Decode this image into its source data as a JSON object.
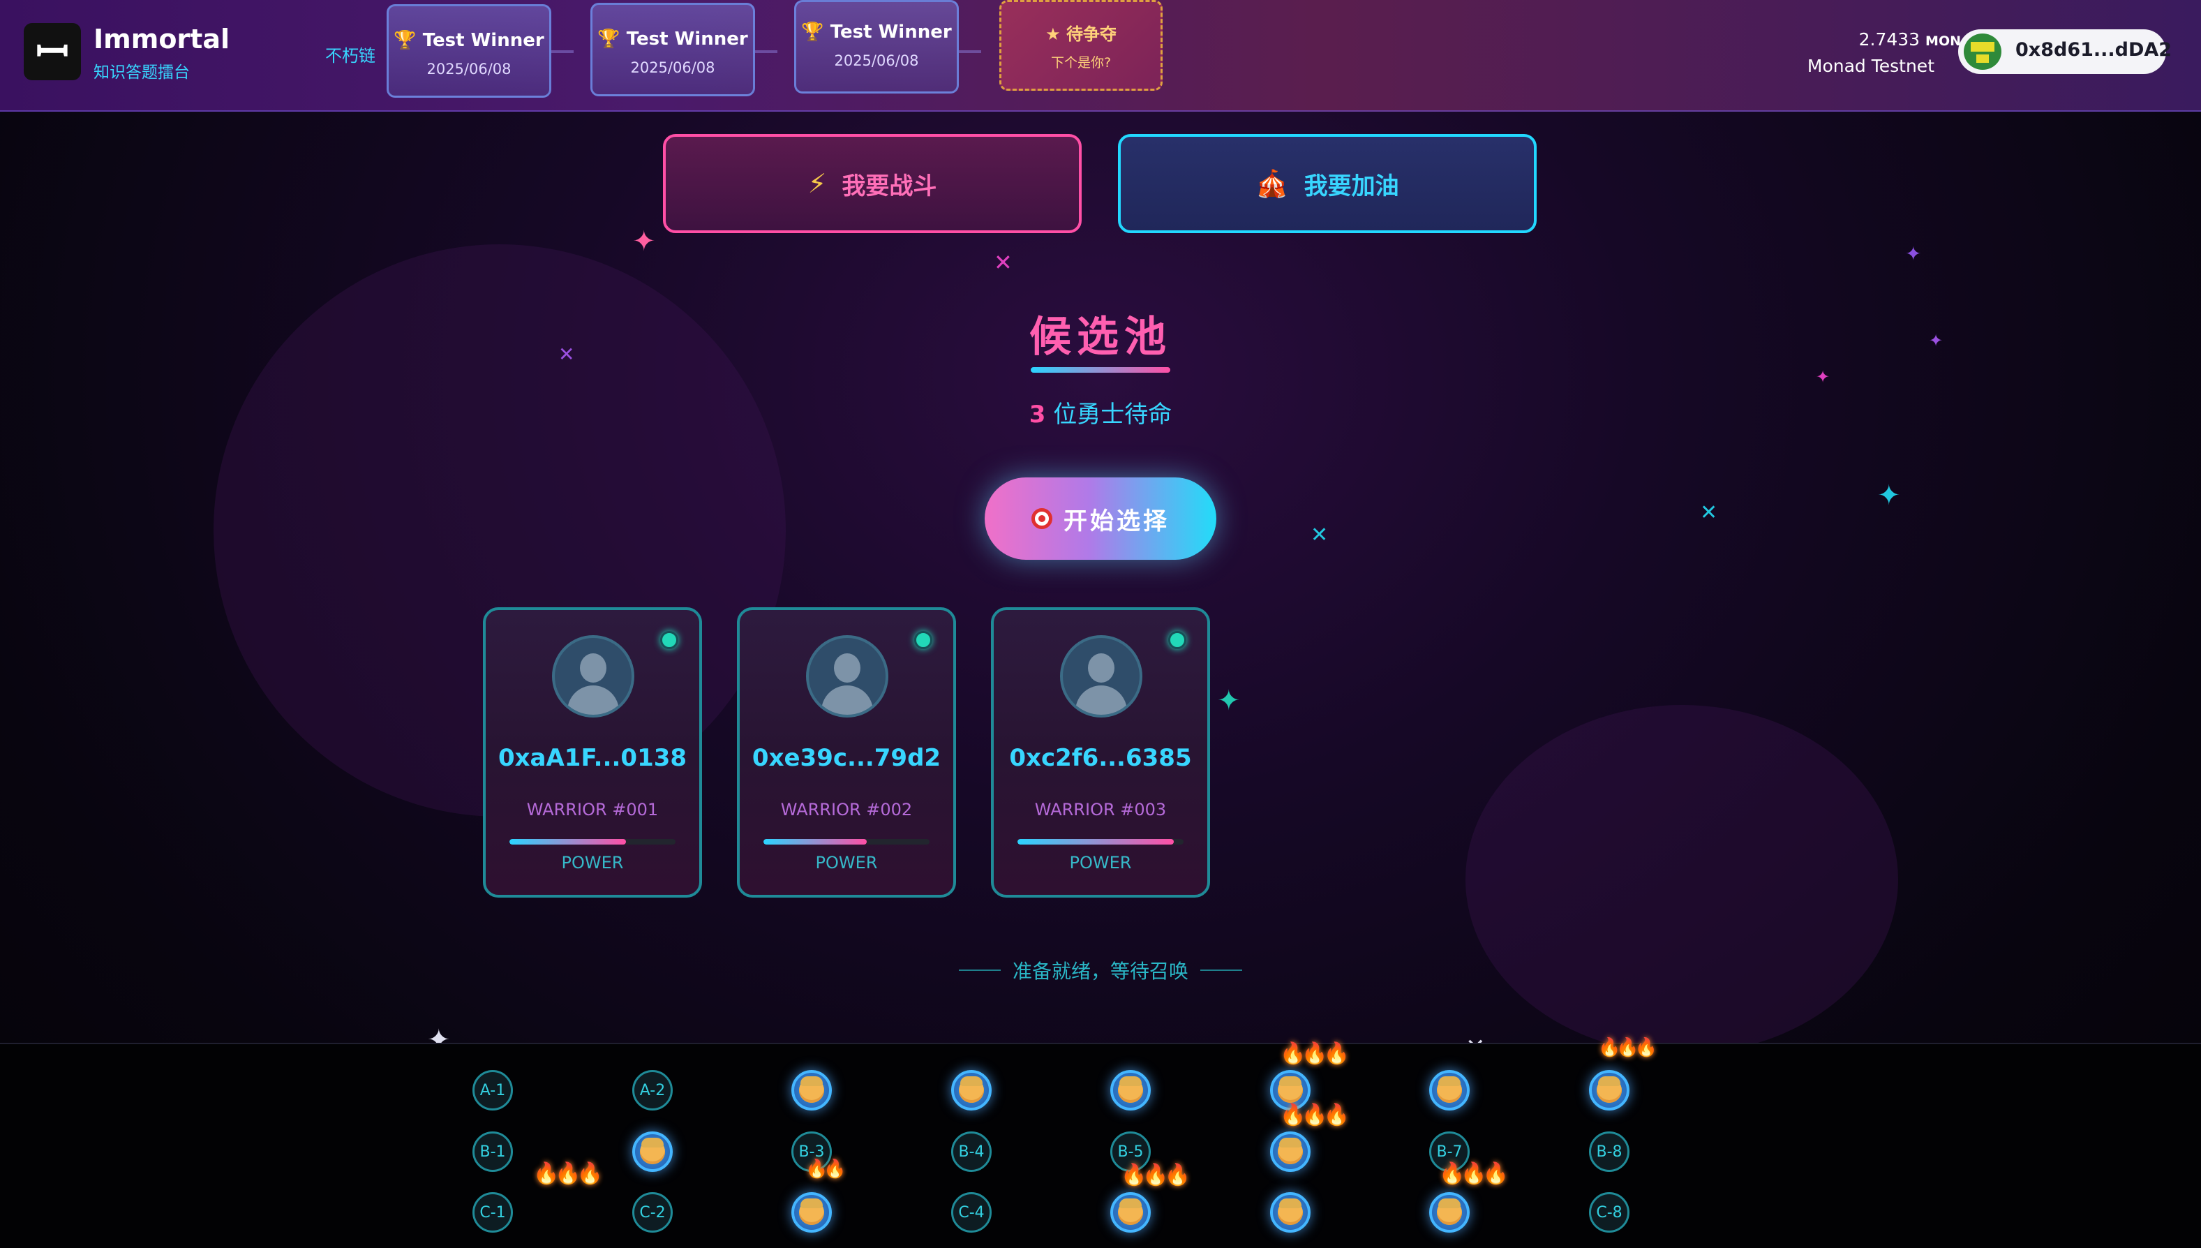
{
  "header": {
    "app_name": "Immortal",
    "app_subtitle": "知识答题擂台",
    "chain_label": "不朽链",
    "winners": [
      {
        "title": "Test Winner",
        "date": "2025/06/08"
      },
      {
        "title": "Test Winner",
        "date": "2025/06/08"
      },
      {
        "title": "Test Winner",
        "date": "2025/06/08"
      }
    ],
    "pending": {
      "title": "待争夺",
      "subtitle": "下个是你?"
    },
    "balance_value": "2.7433",
    "balance_unit": "MON",
    "network": "Monad Testnet",
    "wallet_address": "0x8d61...dDA2"
  },
  "actions": {
    "fight_label": "我要战斗",
    "cheer_label": "我要加油"
  },
  "pool": {
    "title": "候选池",
    "count": "3",
    "count_text": "位勇士待命",
    "start_label": "开始选择",
    "ready_text": "准备就绪，等待召唤"
  },
  "warriors": [
    {
      "address": "0xaA1F...0138",
      "label": "WARRIOR #001",
      "power_label": "POWER",
      "power": 0.7
    },
    {
      "address": "0xe39c...79d2",
      "label": "WARRIOR #002",
      "power_label": "POWER",
      "power": 0.62
    },
    {
      "address": "0xc2f6...6385",
      "label": "WARRIOR #003",
      "power_label": "POWER",
      "power": 0.94
    }
  ],
  "seats": {
    "row_a": [
      {
        "label": "A-1",
        "filled": false
      },
      {
        "label": "A-2",
        "filled": false
      },
      {
        "label": "",
        "filled": true
      },
      {
        "label": "",
        "filled": true
      },
      {
        "label": "",
        "filled": true
      },
      {
        "label": "",
        "filled": true
      },
      {
        "label": "",
        "filled": true
      },
      {
        "label": "",
        "filled": true
      }
    ],
    "row_b": [
      {
        "label": "B-1",
        "filled": false
      },
      {
        "label": "",
        "filled": true
      },
      {
        "label": "B-3",
        "filled": false
      },
      {
        "label": "B-4",
        "filled": false
      },
      {
        "label": "B-5",
        "filled": false
      },
      {
        "label": "",
        "filled": true
      },
      {
        "label": "B-7",
        "filled": false
      },
      {
        "label": "B-8",
        "filled": false
      }
    ],
    "row_c": [
      {
        "label": "C-1",
        "filled": false
      },
      {
        "label": "C-2",
        "filled": false
      },
      {
        "label": "",
        "filled": true
      },
      {
        "label": "C-4",
        "filled": false
      },
      {
        "label": "",
        "filled": true
      },
      {
        "label": "",
        "filled": true
      },
      {
        "label": "",
        "filled": true
      },
      {
        "label": "C-8",
        "filled": false
      }
    ]
  },
  "colors": {
    "pink": "#ff4fa6",
    "cyan": "#38d6ff",
    "teal_border": "#1f8b98"
  }
}
